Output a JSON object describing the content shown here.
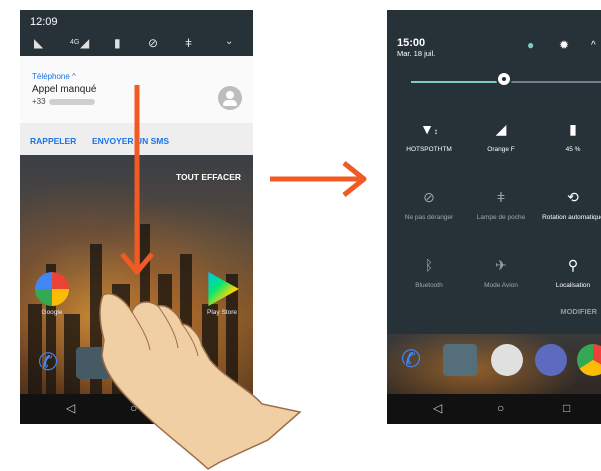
{
  "left_phone": {
    "status_bar": {
      "time": "12:09",
      "network": "4G"
    },
    "notification": {
      "app_name": "Téléphone ^",
      "title": "Appel manqué",
      "number_prefix": "+33",
      "actions": {
        "call_back": "RAPPELER",
        "send_sms": "ENVOYER UN SMS"
      }
    },
    "clear_all": "TOUT EFFACER",
    "apps": [
      {
        "label": "Google"
      },
      {
        "label": "Play Store"
      }
    ]
  },
  "right_phone": {
    "header": {
      "time": "15:00",
      "date": "Mar. 18 juil."
    },
    "brightness": 0.45,
    "tiles": [
      {
        "label": "HOTSPOTHTM",
        "icon": "wifi-icon",
        "active": true
      },
      {
        "label": "Orange F",
        "icon": "signal-icon",
        "active": true
      },
      {
        "label": "45 %",
        "icon": "battery-icon",
        "active": true
      },
      {
        "label": "Ne pas déranger",
        "icon": "do-not-disturb-icon",
        "active": false
      },
      {
        "label": "Lampe de poche",
        "icon": "flashlight-icon",
        "active": false
      },
      {
        "label": "Rotation automatique",
        "icon": "rotation-icon",
        "active": true
      },
      {
        "label": "Bluetooth",
        "icon": "bluetooth-icon",
        "active": false
      },
      {
        "label": "Mode Avion",
        "icon": "airplane-icon",
        "active": false
      },
      {
        "label": "Localisation",
        "icon": "location-icon",
        "active": true
      }
    ],
    "edit": "MODIFIER"
  },
  "colors": {
    "accent": "#1a73e8",
    "arrow": "#f15a24",
    "panel": "#263238",
    "teal": "#80cbc4"
  }
}
